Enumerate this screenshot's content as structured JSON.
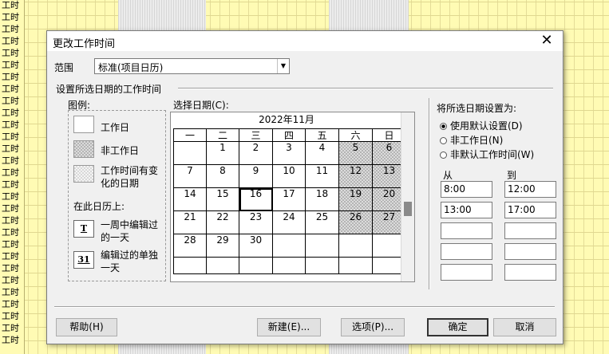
{
  "background": {
    "row_label": "工时",
    "row_count": 29
  },
  "dialog": {
    "title": "更改工作时间",
    "close_glyph": "✕"
  },
  "range": {
    "label": "范围",
    "value": "标准(项目日历)",
    "arrow": "▼"
  },
  "section_title": "设置所选日期的工作时间",
  "legend": {
    "heading": "图例:",
    "working": "工作日",
    "nonworking": "非工作日",
    "changed_line1": "工作时间有变",
    "changed_line2": "化的日期",
    "on_calendar": "在此日历上:",
    "weekday_edit_line1": "一周中编辑过",
    "weekday_edit_line2": "的一天",
    "weekday_icon": "T",
    "single_edit_line1": "编辑过的单独",
    "single_edit_line2": "一天",
    "single_icon": "31"
  },
  "calendar": {
    "label": "选择日期(C):",
    "month": "2022年11月",
    "weekdays": [
      "一",
      "二",
      "三",
      "四",
      "五",
      "六",
      "日"
    ],
    "weeks": [
      [
        "",
        "1",
        "2",
        "3",
        "4",
        "5",
        "6"
      ],
      [
        "7",
        "8",
        "9",
        "10",
        "11",
        "12",
        "13"
      ],
      [
        "14",
        "15",
        "16",
        "17",
        "18",
        "19",
        "20"
      ],
      [
        "21",
        "22",
        "23",
        "24",
        "25",
        "26",
        "27"
      ],
      [
        "28",
        "29",
        "30",
        "",
        "",
        "",
        ""
      ],
      [
        "",
        "",
        "",
        "",
        "",
        "",
        ""
      ]
    ],
    "selected_day": "16"
  },
  "set_dates": {
    "heading": "将所选日期设置为:",
    "options": [
      {
        "label": "使用默认设置(D)",
        "checked": true
      },
      {
        "label": "非工作日(N)",
        "checked": false
      },
      {
        "label": "非默认工作时间(W)",
        "checked": false
      }
    ],
    "from_label": "从",
    "to_label": "到",
    "rows": [
      {
        "from": "8:00",
        "to": "12:00"
      },
      {
        "from": "13:00",
        "to": "17:00"
      },
      {
        "from": "",
        "to": ""
      },
      {
        "from": "",
        "to": ""
      },
      {
        "from": "",
        "to": ""
      }
    ]
  },
  "buttons": {
    "help": "帮助(H)",
    "new": "新建(E)...",
    "options": "选项(P)...",
    "ok": "确定",
    "cancel": "取消"
  }
}
